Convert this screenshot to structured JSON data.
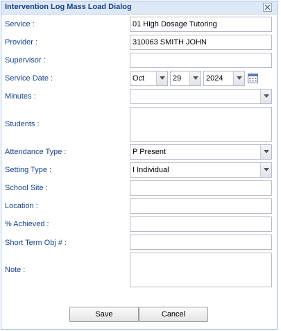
{
  "window": {
    "title": "Intervention Log Mass Load Dialog"
  },
  "form": {
    "service": {
      "label": "Service :",
      "value": "01 High Dosage Tutoring"
    },
    "provider": {
      "label": "Provider :",
      "value": "310063 SMITH JOHN"
    },
    "supervisor": {
      "label": "Supervisor :",
      "value": ""
    },
    "service_date": {
      "label": "Service Date :",
      "month": "Oct",
      "day": "29",
      "year": "2024"
    },
    "minutes": {
      "label": "Minutes :",
      "value": ""
    },
    "students": {
      "label": "Students :",
      "value": ""
    },
    "attendance_type": {
      "label": "Attendance Type :",
      "value": "P Present"
    },
    "setting_type": {
      "label": "Setting Type :",
      "value": "I Individual"
    },
    "school_site": {
      "label": "School Site :",
      "value": ""
    },
    "location": {
      "label": "Location :",
      "value": ""
    },
    "achieved": {
      "label": "% Achieved :",
      "value": ""
    },
    "short_term_obj": {
      "label": "Short Term Obj # :",
      "value": ""
    },
    "note": {
      "label": "Note :",
      "value": ""
    }
  },
  "buttons": {
    "save": "Save",
    "cancel": "Cancel"
  },
  "icons": {
    "close": "close-icon",
    "calendar": "calendar-icon",
    "dropdown": "chevron-down-icon"
  },
  "colors": {
    "label": "#15428b",
    "title_bar": "#dfe8f6",
    "border": "#99bbe8"
  }
}
